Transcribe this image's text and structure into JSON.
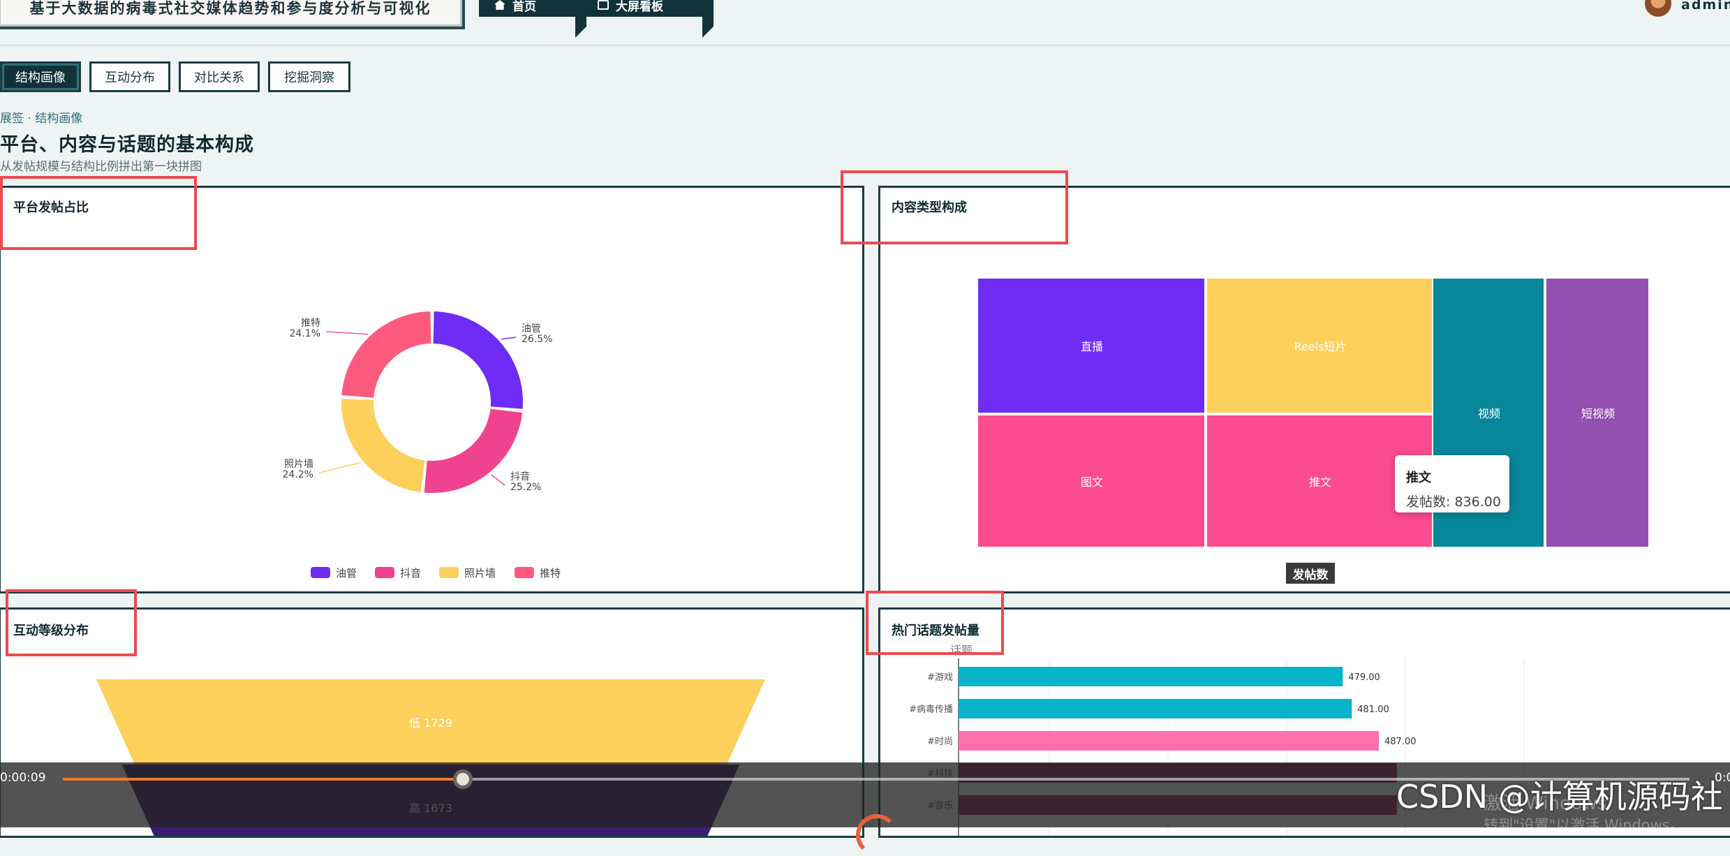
{
  "header": {
    "app_title": "基于大数据的病毒式社交媒体趋势和参与度分析与可视化",
    "nav": [
      {
        "label": "首页",
        "icon": "home-icon"
      },
      {
        "label": "大屏看板",
        "icon": "monitor-icon"
      }
    ],
    "user": "admin"
  },
  "subtabs": [
    "结构画像",
    "互动分布",
    "对比关系",
    "挖掘洞察"
  ],
  "breadcrumb": "展签 · 结构画像",
  "page_title": "平台、内容与话题的基本构成",
  "page_subtitle": "从发帖规模与结构比例拼出第一块拼图",
  "panels": {
    "platform_share": {
      "title": "平台发帖占比"
    },
    "content_types": {
      "title": "内容类型构成",
      "legend_label": "发帖数"
    },
    "engagement_levels": {
      "title": "互动等级分布"
    },
    "hot_topics": {
      "title": "热门话题发帖量",
      "axis_label": "话题"
    }
  },
  "tooltip": {
    "title": "推文",
    "line": "发帖数: 836.00"
  },
  "chart_data": [
    {
      "type": "pie",
      "variant": "donut",
      "slices": [
        {
          "name": "油管",
          "value": 26.5,
          "label": "26.5%",
          "color": "#6f2cf7"
        },
        {
          "name": "抖音",
          "value": 25.2,
          "label": "25.2%",
          "color": "#f0438f"
        },
        {
          "name": "照片墙",
          "value": 24.2,
          "label": "24.2%",
          "color": "#fdd05b"
        },
        {
          "name": "推特",
          "value": 24.1,
          "label": "24.1%",
          "color": "#fd5a7e"
        }
      ],
      "legend": [
        "油管",
        "抖音",
        "照片墙",
        "推特"
      ],
      "legend_position": "bottom"
    },
    {
      "type": "treemap",
      "items": [
        {
          "name": "直播",
          "color": "#6f2cf7"
        },
        {
          "name": "Reels短片",
          "color": "#fdd05b"
        },
        {
          "name": "视频",
          "color": "#06879a"
        },
        {
          "name": "短视频",
          "color": "#9450b0"
        },
        {
          "name": "图文",
          "color": "#fc4b8e"
        },
        {
          "name": "推文",
          "value": 836,
          "color": "#fc4b8e"
        }
      ],
      "legend": [
        "发帖数"
      ]
    },
    {
      "type": "funnel",
      "stages": [
        {
          "name": "低",
          "value": 1729,
          "color": "#fdd05b"
        },
        {
          "name": "高",
          "value": 1673,
          "color": "#3a1d6e"
        }
      ]
    },
    {
      "type": "bar",
      "orientation": "horizontal",
      "ylabel": "话题",
      "categories": [
        "#游戏",
        "#病毒传播",
        "#时尚",
        "#科技",
        "#音乐"
      ],
      "values": [
        479,
        481,
        487,
        491,
        491
      ],
      "value_labels": [
        "479.00",
        "481.00",
        "487.00",
        "",
        ""
      ],
      "category_labels": [
        "#游戏",
        "#病毒传播",
        "#时尚",
        "#科技",
        "#音乐"
      ],
      "colors": [
        "#06b3c9",
        "#06b3c9",
        "#ff6fae",
        "#8a2a5e",
        "#8a2a5e"
      ],
      "xlim": [
        400,
        500
      ]
    }
  ],
  "video": {
    "time_current": "0:00:09",
    "time_total": "0:0",
    "progress": 0.13,
    "watermark": "CSDN @计算机源码社",
    "activate_line1": "激活 Windows",
    "activate_line2": "转到\"设置\"以激活 Windows。"
  }
}
